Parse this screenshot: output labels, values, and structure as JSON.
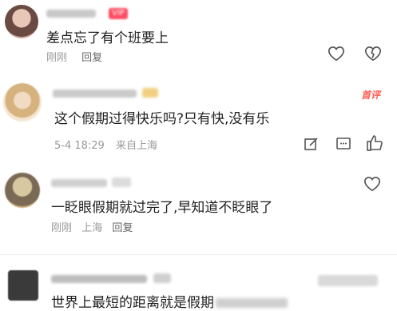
{
  "comments": [
    {
      "text": "差点忘了有个班要上",
      "time": "刚刚",
      "location": "",
      "reply_label": "回复",
      "badge": ""
    },
    {
      "text": "这个假期过得快乐吗?只有快,没有乐",
      "time": "5-4 18:29",
      "location": "来自上海",
      "reply_label": "",
      "hot_label": "首评"
    },
    {
      "text": "一眨眼假期就过完了,早知道不眨眼了",
      "time": "刚刚",
      "location": "上海",
      "reply_label": "回复"
    },
    {
      "text": "世界上最短的距离就是假期",
      "time": "",
      "location": "",
      "reply_label": ""
    }
  ],
  "colors": {
    "accent_red": "#ff4d63",
    "hot_orange": "#ff5a4e",
    "icon_gray": "#555555"
  }
}
